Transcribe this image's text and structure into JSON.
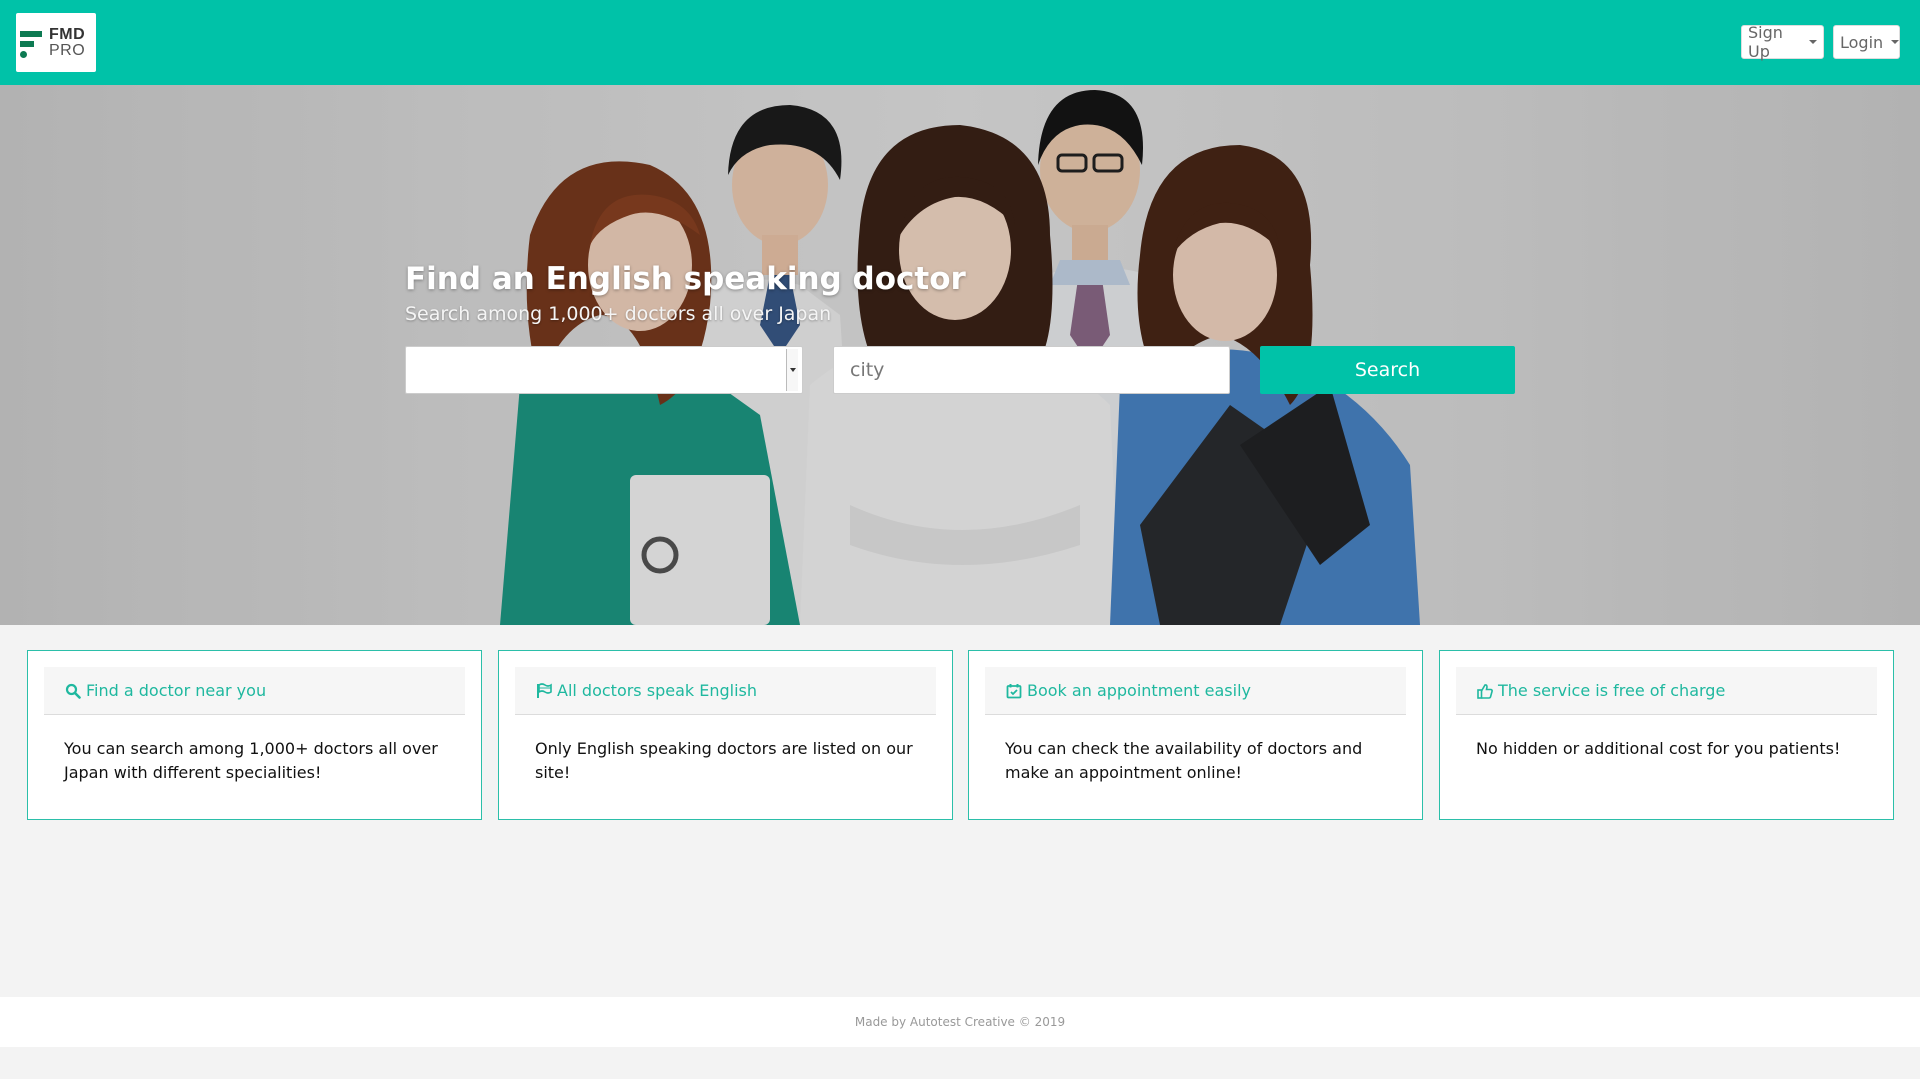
{
  "header": {
    "logo": {
      "line1": "FMD",
      "line2": "PRO"
    },
    "signup_label": "Sign Up",
    "login_label": "Login",
    "brand_color": "#00c2a8"
  },
  "hero": {
    "title": "Find an English speaking doctor",
    "subtitle": "Search among 1,000+ doctors all over Japan",
    "specialty_select": {
      "selected_value": ""
    },
    "city_placeholder": "city",
    "search_label": "Search"
  },
  "features": [
    {
      "icon": "search-icon",
      "title": "Find a doctor near you",
      "text": "You can search among 1,000+ doctors all over Japan with different specialities!"
    },
    {
      "icon": "flag-icon",
      "title": "All doctors speak English",
      "text": "Only English speaking doctors are listed on our site!"
    },
    {
      "icon": "calendar-check-icon",
      "title": "Book an appointment easily",
      "text": "You can check the availability of doctors and make an appointment online!"
    },
    {
      "icon": "thumbs-up-icon",
      "title": "The service is free of charge",
      "text": "No hidden or additional cost for you patients!"
    }
  ],
  "footer": {
    "text": "Made by Autotest Creative © 2019"
  }
}
